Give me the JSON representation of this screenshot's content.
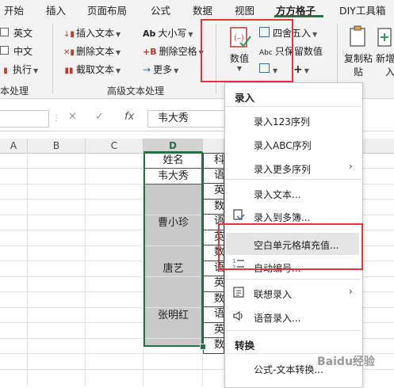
{
  "tabs": [
    "开始",
    "插入",
    "页面布局",
    "公式",
    "数据",
    "视图",
    "方方格子",
    "DIY工具箱"
  ],
  "ribbon": {
    "left_group": {
      "items": [
        "英文",
        "中文",
        "执行"
      ],
      "label": "本处理"
    },
    "advanced_text": {
      "items": [
        {
          "icon": "insert-text-icon",
          "label": "插入文本"
        },
        {
          "icon": "delete-text-icon",
          "label": "删除文本"
        },
        {
          "icon": "extract-text-icon",
          "label": "截取文本"
        },
        {
          "icon": "case-icon",
          "label": "大小写",
          "prefix": "Ab"
        },
        {
          "icon": "delete-space-icon",
          "label": "删除空格",
          "prefix": "+B"
        },
        {
          "icon": "more-icon",
          "label": "更多",
          "prefix": "→"
        }
      ],
      "label": "高级文本处理"
    },
    "numeric": {
      "button_label": "数值",
      "items": [
        {
          "icon": "round-icon",
          "label": "四舍五入"
        },
        {
          "icon": "keep-number-icon",
          "label": "只保留数值",
          "prefix": "Abc"
        }
      ],
      "plus": "+"
    },
    "copy_paste": {
      "label_line1": "复制粘",
      "label_line2": "贴"
    },
    "new_insert": {
      "label_line1": "新增",
      "label_line2": "入"
    }
  },
  "formula_bar": {
    "cancel": "✕",
    "confirm": "✓",
    "fx": "fx",
    "value": "韦大秀"
  },
  "sheet": {
    "columns": [
      "A",
      "B",
      "C",
      "D"
    ],
    "d_column": [
      "姓名",
      "韦大秀",
      "",
      "",
      "曹小珍",
      "",
      "",
      "唐艺",
      "",
      "",
      "张明红",
      "",
      ""
    ],
    "e_column": [
      "科",
      "语",
      "英",
      "数",
      "语",
      "英",
      "数",
      "语",
      "英",
      "数",
      "语",
      "英",
      "数"
    ]
  },
  "menu": {
    "section1": "录入",
    "items1": [
      {
        "label": "录入123序列",
        "icon": "",
        "submenu": false
      },
      {
        "label": "录入ABC序列",
        "icon": "",
        "submenu": false
      },
      {
        "label": "录入更多序列",
        "icon": "",
        "submenu": true
      },
      {
        "label": "录入文本...",
        "icon": "",
        "submenu": false
      },
      {
        "label": "录入到多簿...",
        "icon": "multi-book-icon",
        "submenu": false
      },
      {
        "label": "空白单元格填充值...",
        "icon": "",
        "submenu": false
      },
      {
        "label": "自动编号...",
        "icon": "numbering-icon",
        "submenu": false
      },
      {
        "label": "联想录入",
        "icon": "assoc-input-icon",
        "submenu": true
      },
      {
        "label": "语音录入...",
        "icon": "speaker-icon",
        "submenu": false
      }
    ],
    "section2": "转换",
    "items2": [
      {
        "label": "公式-文本转换...",
        "icon": "",
        "submenu": false
      }
    ]
  },
  "watermark": "Baidu经验",
  "colors": {
    "accent": "#217346",
    "highlight_box": "#e8343f",
    "filled_gray": "#c9c9c9"
  }
}
